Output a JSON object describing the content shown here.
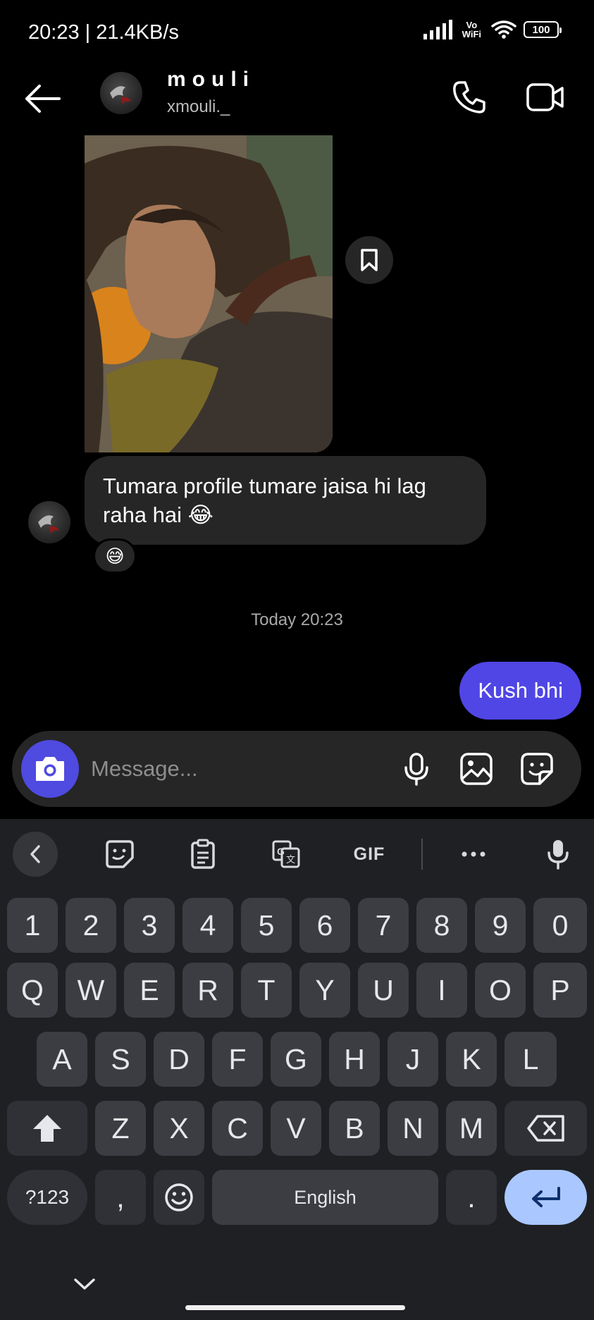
{
  "status_bar": {
    "time_speed": "20:23 | 21.4KB/s",
    "vowifi_top": "Vo",
    "vowifi_bottom": "WiFi",
    "battery": "100"
  },
  "header": {
    "name": "mouli",
    "handle": "xmouli._"
  },
  "chat": {
    "received_text": "Tumara profile tumare jaisa hi lag raha hai 😂",
    "reaction": "😅",
    "timestamp": "Today 20:23",
    "sent_text": "Kush bhi"
  },
  "composer": {
    "placeholder": "Message..."
  },
  "keyboard": {
    "gif_label": "GIF",
    "row_numbers": [
      "1",
      "2",
      "3",
      "4",
      "5",
      "6",
      "7",
      "8",
      "9",
      "0"
    ],
    "row_1": [
      "Q",
      "W",
      "E",
      "R",
      "T",
      "Y",
      "U",
      "I",
      "O",
      "P"
    ],
    "row_2": [
      "A",
      "S",
      "D",
      "F",
      "G",
      "H",
      "J",
      "K",
      "L"
    ],
    "row_3": [
      "Z",
      "X",
      "C",
      "V",
      "B",
      "N",
      "M"
    ],
    "symbols_label": "?123",
    "comma": ",",
    "space_label": "English",
    "period": "."
  },
  "colors": {
    "accent": "#5046e5",
    "bubble": "#262626",
    "keyboard_bg": "#1f2023",
    "key": "#3c3d42",
    "enter_key": "#aac7ff"
  }
}
